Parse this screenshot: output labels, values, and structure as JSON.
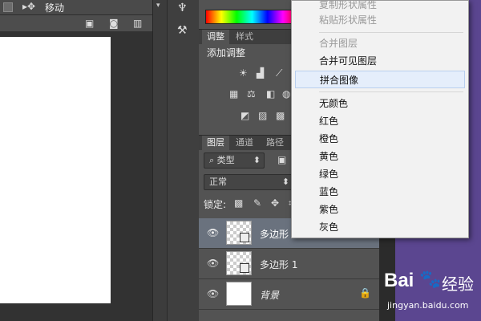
{
  "history": {
    "move_label": "移动"
  },
  "tabs": {
    "adjustments": "调整",
    "styles": "样式",
    "layers": "图层",
    "channels": "通道",
    "paths": "路径"
  },
  "adjustments": {
    "add_adjustment": "添加调整"
  },
  "layers": {
    "filter_kind": "类型",
    "blend_mode": "正常",
    "lock_label": "锁定:",
    "items": [
      {
        "name": "多边形"
      },
      {
        "name": "多边形 1"
      },
      {
        "name": "背景"
      }
    ]
  },
  "menu": {
    "items": [
      {
        "label": "复制形状属性",
        "disabled": true
      },
      {
        "label": "粘贴形状属性",
        "disabled": true
      },
      {
        "label": "合并图层",
        "disabled": true
      },
      {
        "label": "合并可见图层",
        "disabled": false
      },
      {
        "label": "拼合图像",
        "disabled": false,
        "highlighted": true
      },
      {
        "label": "无颜色",
        "disabled": false
      },
      {
        "label": "红色",
        "disabled": false
      },
      {
        "label": "橙色",
        "disabled": false
      },
      {
        "label": "黄色",
        "disabled": false
      },
      {
        "label": "绿色",
        "disabled": false
      },
      {
        "label": "蓝色",
        "disabled": false
      },
      {
        "label": "紫色",
        "disabled": false
      },
      {
        "label": "灰色",
        "disabled": false
      }
    ]
  },
  "watermark": {
    "brand": "Bai",
    "brand2": "经验",
    "url": "jingyan.baidu.com"
  }
}
